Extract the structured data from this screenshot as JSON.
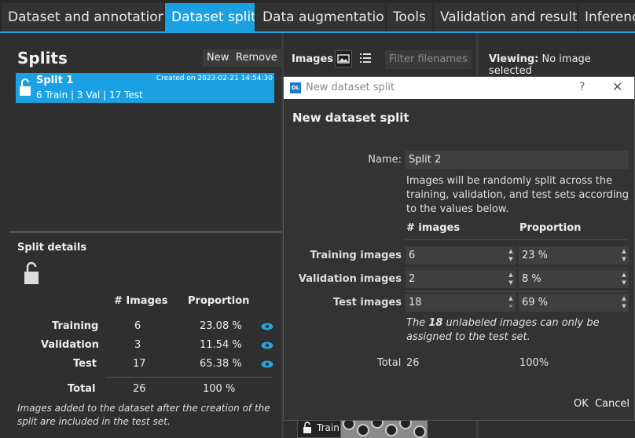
{
  "tabs": [
    "Dataset and annotations",
    "Dataset split",
    "Data augmentation",
    "Tools",
    "Validation and results",
    "Inferenc"
  ],
  "splits_panel": {
    "title": "Splits",
    "new_label": "New",
    "remove_label": "Remove",
    "items": [
      {
        "name": "Split 1",
        "info": "6 Train | 3 Val | 17 Test",
        "created": "Created on 2023-02-21 14:54:30"
      }
    ]
  },
  "split_details": {
    "title": "Split details",
    "col_images": "# Images",
    "col_proportion": "Proportion",
    "rows": [
      {
        "label": "Training",
        "images": "6",
        "proportion": "23.08 %"
      },
      {
        "label": "Validation",
        "images": "3",
        "proportion": "11.54 %"
      },
      {
        "label": "Test",
        "images": "17",
        "proportion": "65.38 %"
      }
    ],
    "total_label": "Total",
    "total_images": "26",
    "total_proportion": "100 %",
    "note": "Images added to the dataset after the creation of the split are included in the test set."
  },
  "images_panel": {
    "label": "Images",
    "filter_placeholder": "Filter filenames",
    "thumb_label": "Train"
  },
  "viewing": {
    "label": "Viewing:",
    "value": "No image selected"
  },
  "dialog": {
    "window_title": "New dataset split",
    "badge": "DL",
    "help": "?",
    "close": "✕",
    "heading": "New dataset split",
    "name_label": "Name:",
    "name_value": "Split 2",
    "description": "Images will be randomly split across the training, validation, and test sets according to the values below.",
    "col_images": "# images",
    "col_proportion": "Proportion",
    "rows": [
      {
        "label": "Training images",
        "images": "6",
        "proportion": "23 %"
      },
      {
        "label": "Validation images",
        "images": "2",
        "proportion": "8 %"
      },
      {
        "label": "Test images",
        "images": "18",
        "proportion": "69 %"
      }
    ],
    "note_pre": "The ",
    "note_count": "18",
    "note_post": " unlabeled images can only be assigned to the test set.",
    "total_label": "Total",
    "total_images": "26",
    "total_proportion": "100%",
    "ok_label": "OK",
    "cancel_label": "Cancel"
  },
  "colors": {
    "accent": "#1ba1e2",
    "eye": "#29a3dc"
  }
}
